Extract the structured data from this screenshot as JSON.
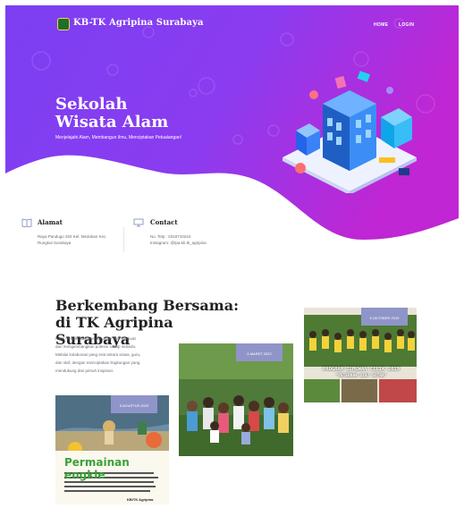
{
  "nav": {
    "brand": "KB-TK Agripina Surabaya",
    "links": [
      "HOME",
      "LOGIN"
    ]
  },
  "hero": {
    "title_line1": "Sekolah",
    "title_line2": "Wisata Alam",
    "subtitle": "Menjelajahi Alam, Membangun Ilmu, Menciptakan Petualangan!"
  },
  "info": {
    "address_title": "Alamat",
    "address_line1": "Raya Pandugo 202 Kel. Medokan Kec.",
    "address_line2": "Rungkut Surabaya",
    "contact_title": "Contact",
    "contact_line1": "No. Telp : 0318710244",
    "contact_line2": "Instagram: @tpa.kb.tk_agripina"
  },
  "section": {
    "title_line1": "Berkembang Bersama:",
    "title_line2": "di TK Agripina Surabaya",
    "body_lines": [
      "Kami mendedikasikan diri untuk memperkuat",
      "dan mengembangkan potensi setiap individu.",
      "Melalui kolaborasi yang erat antara siswa, guru,",
      "dan staf, dengan menciptakan lingkungan yang",
      "mendukung dan penuh inspirasi."
    ]
  },
  "gallery": [
    {
      "date": "5 AGUSTUS 2023",
      "poster_title": "Permainan engkle",
      "poster_footer": "KB/TK Agripina"
    },
    {
      "date": "5 MARET 2023"
    },
    {
      "date": "5 OKTOBER 2019",
      "banner_text": "PROGRAM ILMUWAN CILIK 2019",
      "banner_sub": "\"PETERNAK ULAT SUTRA\""
    }
  ],
  "colors": {
    "hero_start": "#7b3ff2",
    "hero_end": "#c026d3",
    "badge": "#8f95c8",
    "text_dark": "#222222"
  }
}
